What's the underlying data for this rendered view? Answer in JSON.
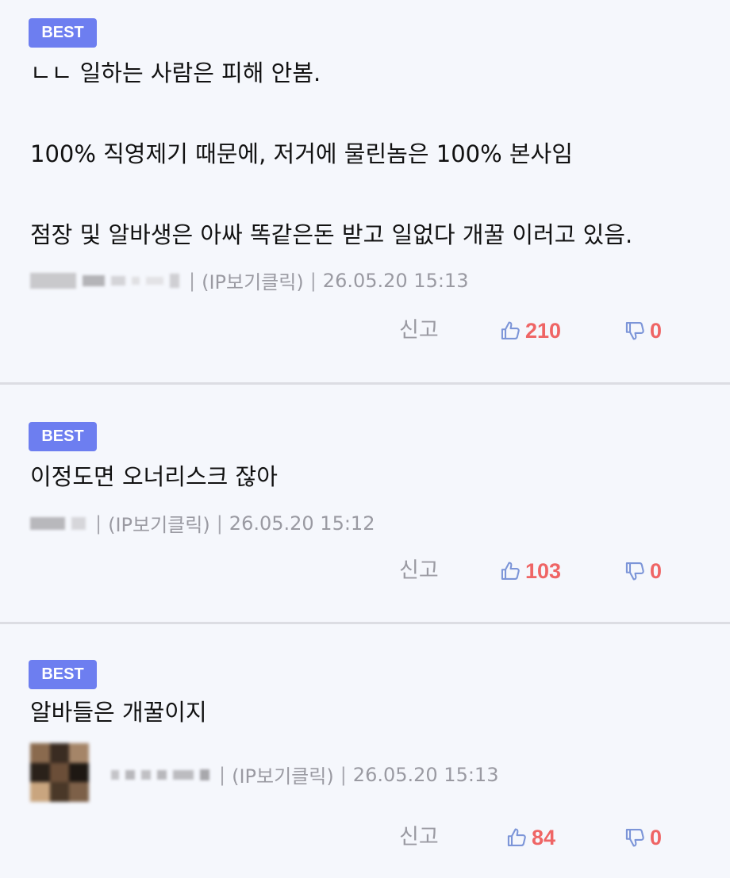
{
  "comments": [
    {
      "badge": "BEST",
      "lines": [
        "ㄴㄴ 일하는 사람은 피해 안봄.",
        "",
        "100% 직영제기 때문에, 저거에 물린놈은 100% 본사임",
        "",
        "점장 및 알바생은 아싸 똑같은돈 받고 일없다 개꿀 이러고 있음."
      ],
      "ip_label": "(IP보기클릭)",
      "timestamp": "26.05.20 15:13",
      "report_label": "신고",
      "likes": "210",
      "dislikes": "0"
    },
    {
      "badge": "BEST",
      "lines": [
        "이정도면 오너리스크 잖아"
      ],
      "ip_label": "(IP보기클릭)",
      "timestamp": "26.05.20 15:12",
      "report_label": "신고",
      "likes": "103",
      "dislikes": "0"
    },
    {
      "badge": "BEST",
      "lines": [
        "알바들은 개꿀이지"
      ],
      "ip_label": "(IP보기클릭)",
      "timestamp": "26.05.20 15:13",
      "report_label": "신고",
      "likes": "84",
      "dislikes": "0"
    }
  ],
  "icons": {
    "like": "thumbs-up-icon",
    "dislike": "thumbs-down-icon"
  },
  "colors": {
    "badge": "#6d7ef0",
    "count": "#ef6565",
    "icon": "#7c95d8",
    "meta": "#9a9aa2",
    "divider": "#dcdde3",
    "background": "#f5f7fc"
  }
}
